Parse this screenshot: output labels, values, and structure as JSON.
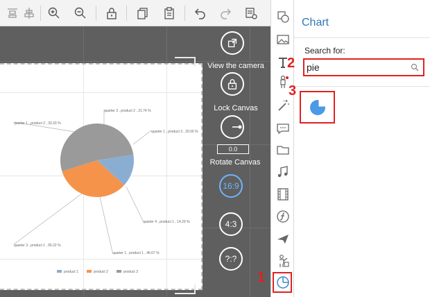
{
  "toolbar": {
    "buttons": [
      "align-top-icon",
      "align-center-icon",
      "zoom-in-icon",
      "zoom-out-icon",
      "lock-icon",
      "copy-icon",
      "paste-icon",
      "undo-icon",
      "redo-icon",
      "properties-icon"
    ]
  },
  "camera": {
    "view_label": "View the camera",
    "lock_label": "Lock Canvas",
    "rotate_value": "0.0",
    "rotate_label": "Rotate Canvas",
    "ratio_16_9": "16:9",
    "ratio_4_3": "4:3",
    "ratio_custom": "?:?"
  },
  "strip": {
    "icons": [
      "shapes-icon",
      "image-icon",
      "text-icon",
      "character-icon",
      "magic-wand-icon",
      "speech-bubble-icon",
      "folder-icon",
      "music-icon",
      "video-icon",
      "formula-icon",
      "airplane-icon",
      "presenter-icon",
      "chart-icon"
    ]
  },
  "panel": {
    "title": "Chart",
    "search_label": "Search for:",
    "search_value": "pie",
    "result_icon": "pie-chart-icon"
  },
  "markers": {
    "m1": "1",
    "m2": "2",
    "m3": "3"
  },
  "colors": {
    "accent": "#2f77b8",
    "highlight": "#e12020",
    "product1": "#8aaed2",
    "product2": "#f5934a",
    "product3": "#9a9a9a"
  },
  "chart_data": {
    "type": "pie",
    "labels": [
      "quarter 3 , product 2 , 21.74 %",
      "quarter 1 , product 3 , 20.00 %",
      "quarter 1 , product 2 , 33.33 %",
      "quarter 4 , product 1 , 14.29 %",
      "quarter 1 , product 1 , 46.67 %",
      "quarter 3 , product 1 , 65.22 %"
    ],
    "legend": [
      "product 1",
      "product 2",
      "product 3"
    ],
    "slices": [
      {
        "series": "product 1",
        "value": 14.29
      },
      {
        "series": "product 2",
        "value": 33.33
      },
      {
        "series": "product 3",
        "value": 52.38
      }
    ]
  }
}
